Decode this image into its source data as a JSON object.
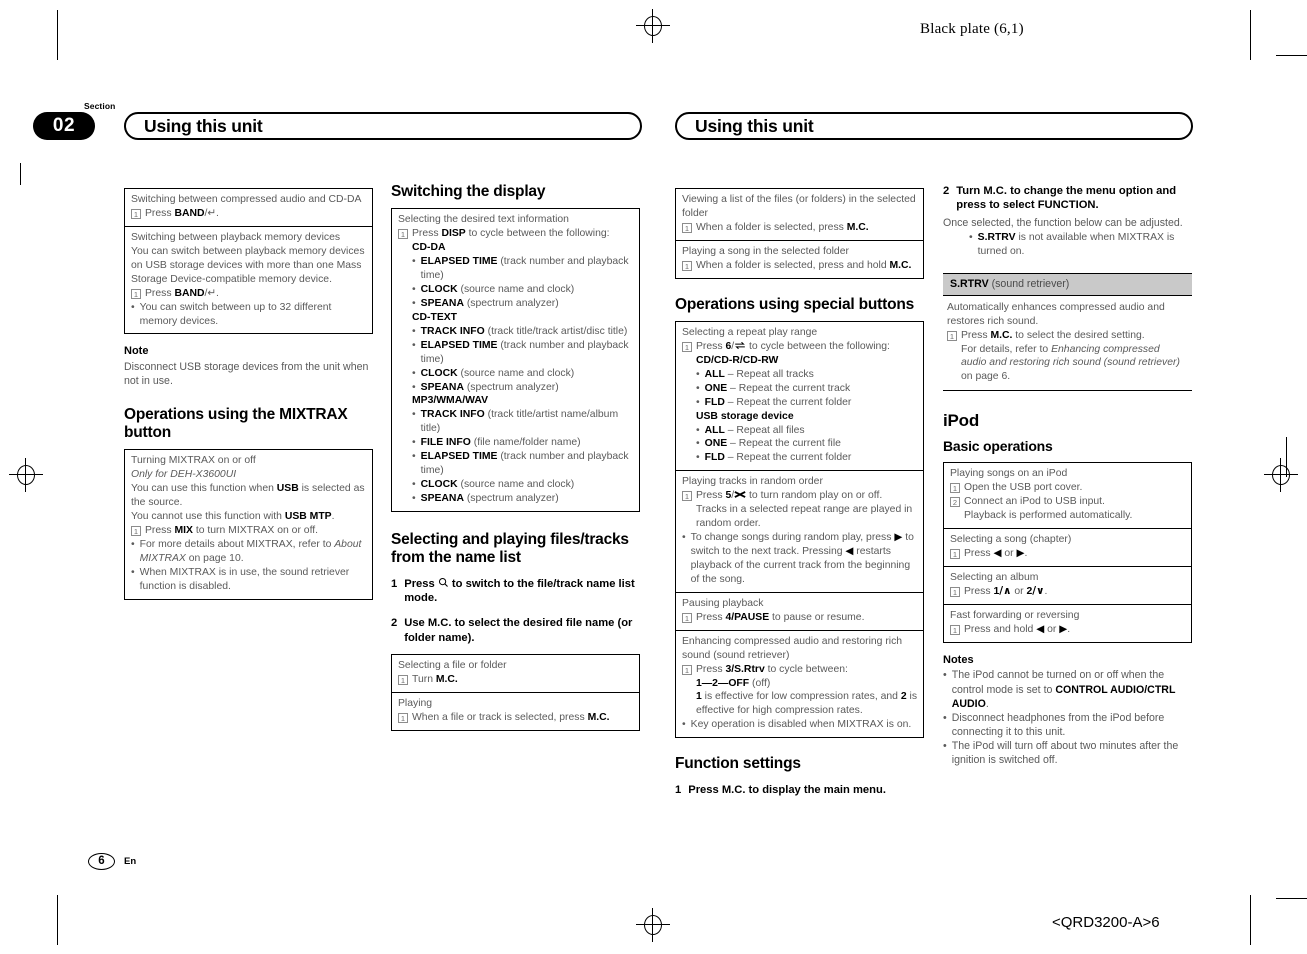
{
  "page": {
    "running_head": "Black plate (6,1)",
    "footer_code": "<QRD3200-A>6",
    "page_number": "6",
    "language": "En",
    "section_label": "Section",
    "section_number": "02",
    "left_header_title": "Using this unit",
    "right_header_title": "Using this unit"
  },
  "col1": {
    "box1": {
      "row1": {
        "title": "Switching between compressed audio and CD-DA",
        "step1_pre": "Press ",
        "step1_bold": "BAND",
        "step1_post": "/↵."
      },
      "row2": {
        "title": "Switching between playback memory devices",
        "body": "You can switch between playback memory devices on USB storage devices with more than one Mass Storage Device-compatible memory device.",
        "step1_pre": "Press ",
        "step1_bold": "BAND",
        "step1_post": "/↵.",
        "bullet1": "You can switch between up to 32 different memory devices."
      }
    },
    "note_heading": "Note",
    "note_text": "Disconnect USB storage devices from the unit when not in use.",
    "heading_mixtrax": "Operations using the MIXTRAX button",
    "box2": {
      "title": "Turning MIXTRAX on or off",
      "subtitle_italic": "Only for DEH-X3600UI",
      "line1_pre": "You can use this function when ",
      "line1_bold": "USB",
      "line1_post": " is selected as the source.",
      "line2_pre": "You cannot use this function with ",
      "line2_bold": "USB MTP",
      "line2_post": ".",
      "step1_pre": "Press ",
      "step1_bold": "MIX",
      "step1_post": " to turn MIXTRAX on or off.",
      "bullet1_pre": "For more details about MIXTRAX, refer to ",
      "bullet1_italic": "About MIXTRAX",
      "bullet1_post": " on page 10.",
      "bullet2": "When MIXTRAX is in use, the sound retriever function is disabled."
    }
  },
  "col2": {
    "heading_display": "Switching the display",
    "box1": {
      "title": "Selecting the desired text information",
      "step1_pre": "Press ",
      "step1_bold": "DISP",
      "step1_post": " to cycle between the following:",
      "groups": [
        {
          "name": "CD-DA",
          "items": [
            {
              "bold": "ELAPSED TIME",
              "rest": " (track number and playback time)"
            },
            {
              "bold": "CLOCK",
              "rest": " (source name and clock)"
            },
            {
              "bold": "SPEANA",
              "rest": " (spectrum analyzer)"
            }
          ]
        },
        {
          "name": "CD-TEXT",
          "items": [
            {
              "bold": "TRACK INFO",
              "rest": " (track title/track artist/disc title)"
            },
            {
              "bold": "ELAPSED TIME",
              "rest": " (track number and playback time)"
            },
            {
              "bold": "CLOCK",
              "rest": " (source name and clock)"
            },
            {
              "bold": "SPEANA",
              "rest": " (spectrum analyzer)"
            }
          ]
        },
        {
          "name": "MP3/WMA/WAV",
          "items": [
            {
              "bold": "TRACK INFO",
              "rest": " (track title/artist name/album title)"
            },
            {
              "bold": "FILE INFO",
              "rest": " (file name/folder name)"
            },
            {
              "bold": "ELAPSED TIME",
              "rest": " (track number and playback time)"
            },
            {
              "bold": "CLOCK",
              "rest": " (source name and clock)"
            },
            {
              "bold": "SPEANA",
              "rest": " (spectrum analyzer)"
            }
          ]
        }
      ]
    },
    "heading_namelist": "Selecting and playing files/tracks from the name list",
    "step1_num": "1",
    "step1_pre": "Press ",
    "step1_icon": "search-icon",
    "step1_post": " to switch to the file/track name list mode.",
    "step2_num": "2",
    "step2_text": "Use M.C. to select the desired file name (or folder name).",
    "box2": {
      "row1": {
        "title": "Selecting a file or folder",
        "step1_pre": "Turn ",
        "step1_bold": "M.C.",
        "step1_post": ""
      },
      "row2": {
        "title": "Playing",
        "step1_pre": "When a file or track is selected, press ",
        "step1_bold": "M.C.",
        "step1_post": ""
      }
    }
  },
  "col3": {
    "box1": {
      "row1": {
        "title": "Viewing a list of the files (or folders) in the selected folder",
        "step1_pre": "When a folder is selected, press ",
        "step1_bold": "M.C.",
        "step1_post": ""
      },
      "row2": {
        "title": "Playing a song in the selected folder",
        "step1_pre": "When a folder is selected, press and hold ",
        "step1_bold": "M.C.",
        "step1_post": ""
      }
    },
    "heading_special": "Operations using special buttons",
    "box2": {
      "row1": {
        "title": "Selecting a repeat play range",
        "step1_pre": "Press ",
        "step1_bold": "6",
        "step1_icon": "repeat-icon",
        "step1_post": " to cycle between the following:",
        "groups": [
          {
            "name": "CD/CD-R/CD-RW",
            "items": [
              {
                "bold": "ALL",
                "rest": " – Repeat all tracks"
              },
              {
                "bold": "ONE",
                "rest": " – Repeat the current track"
              },
              {
                "bold": "FLD",
                "rest": " – Repeat the current folder"
              }
            ]
          },
          {
            "name": "USB storage device",
            "items": [
              {
                "bold": "ALL",
                "rest": " – Repeat all files"
              },
              {
                "bold": "ONE",
                "rest": " – Repeat the current file"
              },
              {
                "bold": "FLD",
                "rest": " – Repeat the current folder"
              }
            ]
          }
        ]
      },
      "row2": {
        "title": "Playing tracks in random order",
        "step1_pre": "Press ",
        "step1_bold": "5",
        "step1_icon": "shuffle-icon",
        "step1_post": " to turn random play on or off.",
        "step1_cont": "Tracks in a selected repeat range are played in random order.",
        "bullet1_a": "To change songs during random play, press ",
        "bullet1_arrow1": "▶",
        "bullet1_b": " to switch to the next track. Pressing ",
        "bullet1_arrow2": "◀",
        "bullet1_c": " restarts playback of the current track from the beginning of the song."
      },
      "row3": {
        "title": "Pausing playback",
        "step1_pre": "Press ",
        "step1_bold": "4/PAUSE",
        "step1_post": " to pause or resume."
      },
      "row4": {
        "title": "Enhancing compressed audio and restoring rich sound (sound retriever)",
        "step1_pre": "Press ",
        "step1_bold": "3/S.Rtrv",
        "step1_post": " to cycle between:",
        "cycle_bold": "1—2—OFF",
        "cycle_rest": " (off)",
        "cont_a": "1",
        "cont_b": " is effective for low compression rates, and ",
        "cont_c": "2",
        "cont_d": " is effective for high compression rates.",
        "bullet1": "Key operation is disabled when MIXTRAX is on."
      }
    },
    "heading_function": "Function settings",
    "step1_num": "1",
    "step1_text": "Press M.C. to display the main menu."
  },
  "col4": {
    "step2_num": "2",
    "step2_text": "Turn M.C. to change the menu option and press to select FUNCTION.",
    "step2_body": "Once selected, the function below can be adjusted.",
    "step2_bullet_bold": "S.RTRV",
    "step2_bullet_rest": " is not available when MIXTRAX is turned on.",
    "fnblock": {
      "head_bold": "S.RTRV",
      "head_rest": " (sound retriever)",
      "body_line1": "Automatically enhances compressed audio and restores rich sound.",
      "step1_pre": "Press ",
      "step1_bold": "M.C.",
      "step1_post": " to select the desired setting.",
      "detail_pre": "For details, refer to ",
      "detail_italic": "Enhancing compressed audio and restoring rich sound (sound retriever)",
      "detail_post": " on page 6."
    },
    "heading_ipod": "iPod",
    "heading_basic": "Basic operations",
    "box1": {
      "row1": {
        "title": "Playing songs on an iPod",
        "step1": "Open the USB port cover.",
        "step2": "Connect an iPod to USB input.",
        "step2_cont": "Playback is performed automatically."
      },
      "row2": {
        "title": "Selecting a song (chapter)",
        "step1_pre": "Press ",
        "step1_arrow1": "◀",
        "step1_mid": " or ",
        "step1_arrow2": "▶",
        "step1_post": "."
      },
      "row3": {
        "title": "Selecting an album",
        "step1_pre": "Press ",
        "step1_b1": "1",
        "step1_up": "/∧",
        "step1_mid": " or ",
        "step1_b2": "2",
        "step1_dn": "/∨",
        "step1_post": "."
      },
      "row4": {
        "title": "Fast forwarding or reversing",
        "step1_pre": "Press and hold ",
        "step1_arrow1": "◀",
        "step1_mid": " or ",
        "step1_arrow2": "▶",
        "step1_post": "."
      }
    },
    "notes_heading": "Notes",
    "note1_pre": "The iPod cannot be turned on or off when the control mode is set to ",
    "note1_bold": "CONTROL AUDIO/CTRL AUDIO",
    "note1_post": ".",
    "note2": "Disconnect headphones from the iPod before connecting it to this unit.",
    "note3": "The iPod will turn off about two minutes after the ignition is switched off."
  }
}
